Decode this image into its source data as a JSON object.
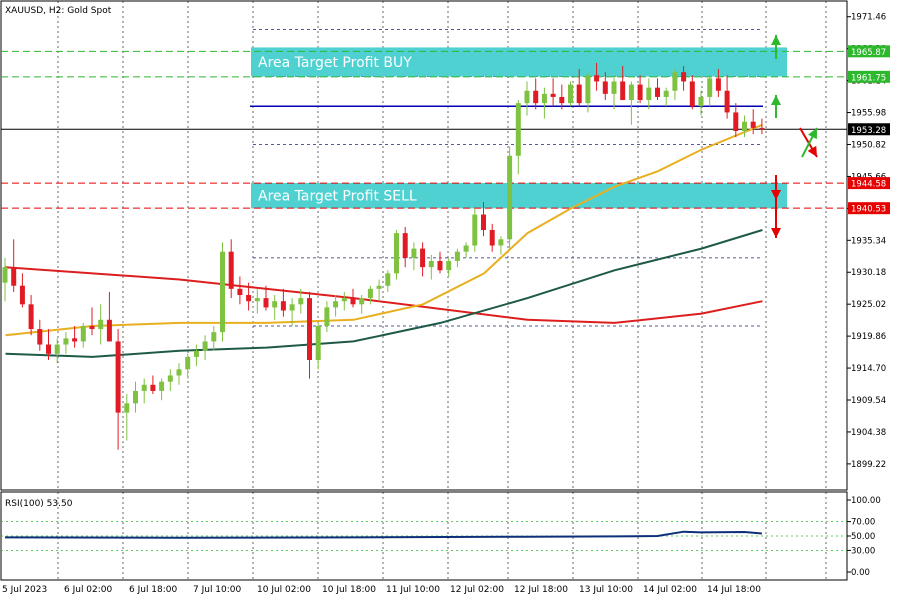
{
  "header": {
    "symbol": "XAUUSD",
    "timeframe": "H2",
    "description": "Gold Spot"
  },
  "chart_data": {
    "type": "candlestick",
    "price_axis": {
      "ylim": [
        1895.0,
        1974.0
      ],
      "ticks": [
        "1971.46",
        "1966.30",
        "1961.14",
        "1955.98",
        "1950.82",
        "1945.66",
        "1940.50",
        "1935.34",
        "1930.18",
        "1925.02",
        "1919.86",
        "1914.70",
        "1909.54",
        "1904.38",
        "1899.22"
      ]
    },
    "time_axis": {
      "labels": [
        "5 Jul 2023",
        "6 Jul 02:00",
        "6 Jul 18:00",
        "7 Jul 10:00",
        "10 Jul 02:00",
        "10 Jul 18:00",
        "11 Jul 10:00",
        "12 Jul 02:00",
        "12 Jul 18:00",
        "13 Jul 10:00",
        "14 Jul 02:00",
        "14 Jul 18:00"
      ]
    },
    "price_labels": [
      {
        "text": "1965.87",
        "value": 1965.87,
        "color": "#2eb82e"
      },
      {
        "text": "1961.75",
        "value": 1961.75,
        "color": "#2eb82e"
      },
      {
        "text": "1953.28",
        "value": 1953.28,
        "color": "#000000"
      },
      {
        "text": "1944.58",
        "value": 1944.58,
        "color": "#e60000"
      },
      {
        "text": "1940.53",
        "value": 1940.53,
        "color": "#e60000"
      }
    ],
    "zones": [
      {
        "label": "Area Target Profit BUY",
        "top": 1966.5,
        "bottom": 1961.8
      },
      {
        "label": "Area Target Profit SELL",
        "top": 1944.6,
        "bottom": 1940.5
      }
    ],
    "candles": [
      [
        1928.5,
        1932.5,
        1925.5,
        1931.0
      ],
      [
        1931.0,
        1935.5,
        1927.0,
        1928.0
      ],
      [
        1928.0,
        1930.0,
        1924.5,
        1925.0
      ],
      [
        1925.0,
        1926.5,
        1920.0,
        1921.0
      ],
      [
        1921.0,
        1922.5,
        1917.5,
        1918.5
      ],
      [
        1918.5,
        1921.0,
        1916.0,
        1917.0
      ],
      [
        1917.0,
        1919.5,
        1915.5,
        1918.5
      ],
      [
        1918.5,
        1920.5,
        1917.0,
        1919.5
      ],
      [
        1919.5,
        1921.5,
        1918.0,
        1919.0
      ],
      [
        1919.0,
        1922.0,
        1918.0,
        1921.5
      ],
      [
        1921.5,
        1924.5,
        1920.0,
        1921.0
      ],
      [
        1921.0,
        1925.0,
        1918.5,
        1922.5
      ],
      [
        1922.5,
        1927.0,
        1921.0,
        1919.0
      ],
      [
        1919.0,
        1921.0,
        1901.5,
        1907.5
      ],
      [
        1907.5,
        1910.5,
        1903.0,
        1909.0
      ],
      [
        1909.0,
        1912.5,
        1907.5,
        1911.0
      ],
      [
        1911.0,
        1913.0,
        1909.0,
        1912.0
      ],
      [
        1912.0,
        1913.5,
        1910.5,
        1911.0
      ],
      [
        1911.0,
        1913.0,
        1909.5,
        1912.5
      ],
      [
        1912.5,
        1914.5,
        1911.0,
        1913.5
      ],
      [
        1913.5,
        1915.5,
        1912.0,
        1914.5
      ],
      [
        1914.5,
        1917.0,
        1913.0,
        1916.5
      ],
      [
        1916.5,
        1918.5,
        1915.0,
        1917.5
      ],
      [
        1917.5,
        1920.0,
        1916.0,
        1919.0
      ],
      [
        1919.0,
        1921.5,
        1917.5,
        1920.5
      ],
      [
        1920.5,
        1935.0,
        1919.0,
        1933.5
      ],
      [
        1933.5,
        1935.5,
        1926.0,
        1927.5
      ],
      [
        1927.5,
        1929.5,
        1925.0,
        1926.5
      ],
      [
        1926.5,
        1928.5,
        1924.0,
        1925.5
      ],
      [
        1925.5,
        1927.5,
        1923.5,
        1926.0
      ],
      [
        1926.0,
        1928.0,
        1924.0,
        1924.5
      ],
      [
        1924.5,
        1926.5,
        1922.5,
        1925.5
      ],
      [
        1925.5,
        1927.5,
        1923.0,
        1924.0
      ],
      [
        1924.0,
        1926.0,
        1921.5,
        1925.0
      ],
      [
        1925.0,
        1927.5,
        1923.5,
        1926.0
      ],
      [
        1926.0,
        1927.0,
        1913.0,
        1916.0
      ],
      [
        1916.0,
        1922.0,
        1914.5,
        1921.5
      ],
      [
        1921.5,
        1925.5,
        1920.5,
        1924.5
      ],
      [
        1924.5,
        1926.5,
        1923.0,
        1925.5
      ],
      [
        1925.5,
        1927.0,
        1924.0,
        1926.0
      ],
      [
        1926.0,
        1927.5,
        1924.5,
        1925.0
      ],
      [
        1925.0,
        1926.5,
        1923.5,
        1926.0
      ],
      [
        1926.0,
        1928.0,
        1925.0,
        1927.5
      ],
      [
        1927.5,
        1929.0,
        1925.5,
        1928.0
      ],
      [
        1928.0,
        1930.5,
        1927.0,
        1930.0
      ],
      [
        1930.0,
        1937.0,
        1929.0,
        1936.5
      ],
      [
        1936.5,
        1937.5,
        1931.0,
        1932.5
      ],
      [
        1932.5,
        1935.0,
        1930.5,
        1934.0
      ],
      [
        1934.0,
        1935.0,
        1929.5,
        1931.0
      ],
      [
        1931.0,
        1933.0,
        1929.0,
        1932.0
      ],
      [
        1932.0,
        1933.5,
        1930.0,
        1930.5
      ],
      [
        1930.5,
        1932.5,
        1929.5,
        1932.0
      ],
      [
        1932.0,
        1934.0,
        1931.0,
        1933.5
      ],
      [
        1933.5,
        1935.0,
        1932.5,
        1934.5
      ],
      [
        1934.5,
        1940.5,
        1933.5,
        1939.5
      ],
      [
        1939.5,
        1941.5,
        1936.0,
        1937.0
      ],
      [
        1937.0,
        1938.0,
        1933.5,
        1934.5
      ],
      [
        1934.5,
        1936.0,
        1933.0,
        1935.5
      ],
      [
        1935.5,
        1950.5,
        1934.0,
        1949.0
      ],
      [
        1949.0,
        1958.0,
        1946.0,
        1957.5
      ],
      [
        1957.5,
        1961.0,
        1955.5,
        1959.5
      ],
      [
        1959.5,
        1961.5,
        1956.5,
        1957.5
      ],
      [
        1957.5,
        1960.0,
        1955.0,
        1959.0
      ],
      [
        1959.0,
        1961.5,
        1957.0,
        1958.5
      ],
      [
        1958.5,
        1960.5,
        1956.5,
        1957.5
      ],
      [
        1957.5,
        1961.0,
        1957.0,
        1960.5
      ],
      [
        1960.5,
        1963.0,
        1957.0,
        1957.5
      ],
      [
        1957.5,
        1962.5,
        1956.0,
        1962.0
      ],
      [
        1962.0,
        1964.0,
        1959.5,
        1961.0
      ],
      [
        1961.0,
        1962.5,
        1958.0,
        1959.0
      ],
      [
        1959.0,
        1962.0,
        1956.5,
        1961.0
      ],
      [
        1961.0,
        1963.5,
        1959.5,
        1958.0
      ],
      [
        1958.0,
        1961.0,
        1954.0,
        1960.5
      ],
      [
        1960.5,
        1962.0,
        1957.5,
        1958.0
      ],
      [
        1958.0,
        1961.5,
        1956.5,
        1960.0
      ],
      [
        1960.0,
        1961.5,
        1958.0,
        1958.5
      ],
      [
        1958.5,
        1960.0,
        1957.0,
        1959.5
      ],
      [
        1959.5,
        1963.0,
        1958.0,
        1962.5
      ],
      [
        1962.5,
        1963.5,
        1959.5,
        1961.0
      ],
      [
        1961.0,
        1962.0,
        1956.5,
        1957.0
      ],
      [
        1957.0,
        1959.5,
        1955.5,
        1958.5
      ],
      [
        1958.5,
        1962.0,
        1957.0,
        1961.5
      ],
      [
        1961.5,
        1963.0,
        1958.5,
        1959.5
      ],
      [
        1959.5,
        1962.0,
        1955.0,
        1956.0
      ],
      [
        1956.0,
        1957.5,
        1952.0,
        1953.0
      ],
      [
        1953.0,
        1955.5,
        1952.0,
        1954.5
      ],
      [
        1954.5,
        1956.5,
        1952.5,
        1953.5
      ],
      [
        1953.5,
        1955.0,
        1952.5,
        1953.28
      ]
    ],
    "moving_averages": [
      {
        "color": "#dc1e1e",
        "points": [
          [
            0,
            1931.0
          ],
          [
            20,
            1929.0
          ],
          [
            40,
            1926.0
          ],
          [
            60,
            1922.5
          ],
          [
            70,
            1922.0
          ],
          [
            80,
            1923.5
          ],
          [
            87,
            1925.5
          ]
        ]
      },
      {
        "color": "#e8b020",
        "points": [
          [
            0,
            1920.0
          ],
          [
            10,
            1921.5
          ],
          [
            20,
            1922.0
          ],
          [
            30,
            1922.0
          ],
          [
            40,
            1922.5
          ],
          [
            48,
            1925.0
          ],
          [
            55,
            1930.0
          ],
          [
            60,
            1936.5
          ],
          [
            65,
            1940.5
          ],
          [
            70,
            1944.0
          ],
          [
            75,
            1946.5
          ],
          [
            80,
            1950.0
          ],
          [
            87,
            1954.0
          ]
        ]
      },
      {
        "color": "#1e5a46",
        "points": [
          [
            0,
            1917.0
          ],
          [
            10,
            1916.5
          ],
          [
            20,
            1917.5
          ],
          [
            30,
            1918.0
          ],
          [
            40,
            1919.0
          ],
          [
            50,
            1922.0
          ],
          [
            60,
            1926.0
          ],
          [
            70,
            1930.5
          ],
          [
            80,
            1934.0
          ],
          [
            87,
            1937.0
          ]
        ]
      }
    ],
    "annotation_arrows": [
      {
        "x1": 776,
        "y1": 118,
        "x2": 776,
        "y2": 95,
        "color": "#2eb82e"
      },
      {
        "x1": 776,
        "y1": 59,
        "x2": 776,
        "y2": 35,
        "color": "#2eb82e"
      },
      {
        "x1": 800,
        "y1": 128,
        "x2": 817,
        "y2": 157,
        "color": "#e60000"
      },
      {
        "x1": 802,
        "y1": 157,
        "x2": 817,
        "y2": 128,
        "color": "#2eb82e"
      },
      {
        "x1": 776,
        "y1": 175,
        "x2": 776,
        "y2": 200,
        "color": "#e60000"
      },
      {
        "x1": 776,
        "y1": 200,
        "x2": 776,
        "y2": 238,
        "color": "#e60000"
      }
    ],
    "rsi": {
      "label": "RSI(100) 53.50",
      "ylim": [
        0,
        100
      ],
      "ticks": [
        "100.00",
        "70.00",
        "50.00",
        "30.00",
        "0.00"
      ],
      "series": [
        [
          0,
          48
        ],
        [
          20,
          47.5
        ],
        [
          40,
          48
        ],
        [
          60,
          49
        ],
        [
          70,
          49.5
        ],
        [
          75,
          50
        ],
        [
          78,
          56
        ],
        [
          80,
          55
        ],
        [
          85,
          55.5
        ],
        [
          87,
          53.5
        ]
      ]
    }
  }
}
